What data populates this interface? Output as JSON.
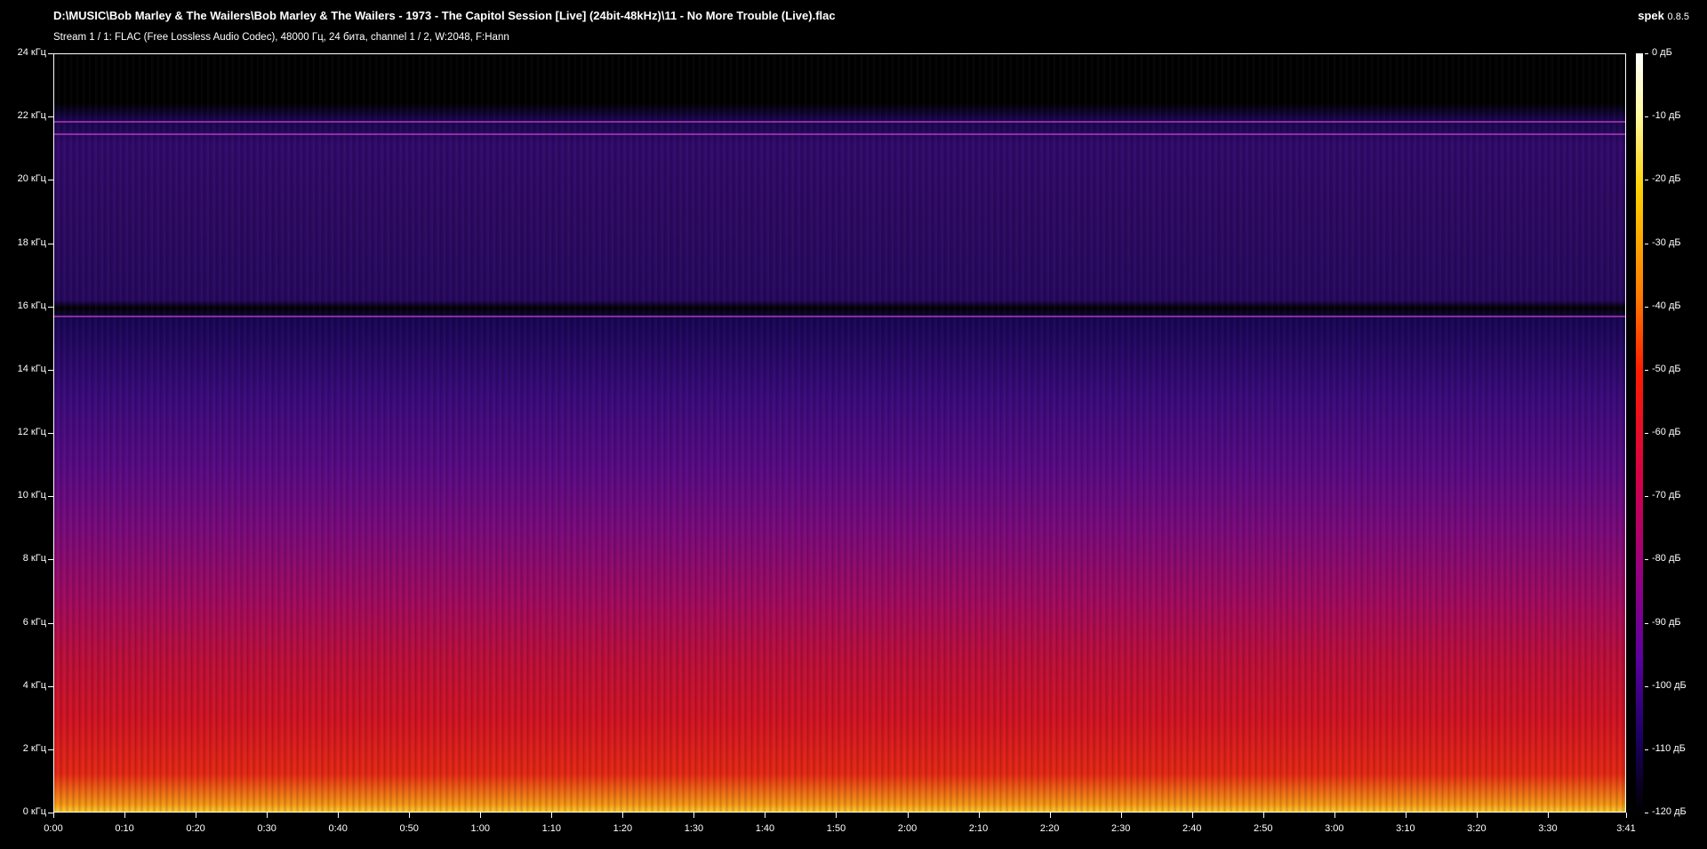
{
  "header": {
    "title": "D:\\MUSIC\\Bob Marley & The Wailers\\Bob Marley & The Wailers - 1973 - The Capitol Session [Live] (24bit-48kHz)\\11 - No More Trouble (Live).flac",
    "subtitle": "Stream 1 / 1: FLAC (Free Lossless Audio Codec), 48000 Гц, 24 бита, channel 1 / 2, W:2048, F:Hann",
    "app_name": "spek",
    "app_version": "0.8.5"
  },
  "axes": {
    "y_labels": [
      "24 кГц",
      "22 кГц",
      "20 кГц",
      "18 кГц",
      "16 кГц",
      "14 кГц",
      "12 кГц",
      "10 кГц",
      "8 кГц",
      "6 кГц",
      "4 кГц",
      "2 кГц",
      "0 кГц"
    ],
    "x_labels": [
      "0:00",
      "0:10",
      "0:20",
      "0:30",
      "0:40",
      "0:50",
      "1:00",
      "1:10",
      "1:20",
      "1:30",
      "1:40",
      "1:50",
      "2:00",
      "2:10",
      "2:20",
      "2:30",
      "2:40",
      "2:50",
      "3:00",
      "3:10",
      "3:20",
      "3:30",
      "3:41"
    ],
    "db_labels": [
      "0 дБ",
      "-10 дБ",
      "-20 дБ",
      "-30 дБ",
      "-40 дБ",
      "-50 дБ",
      "-60 дБ",
      "-70 дБ",
      "-80 дБ",
      "-90 дБ",
      "-100 дБ",
      "-110 дБ",
      "-120 дБ"
    ]
  }
}
